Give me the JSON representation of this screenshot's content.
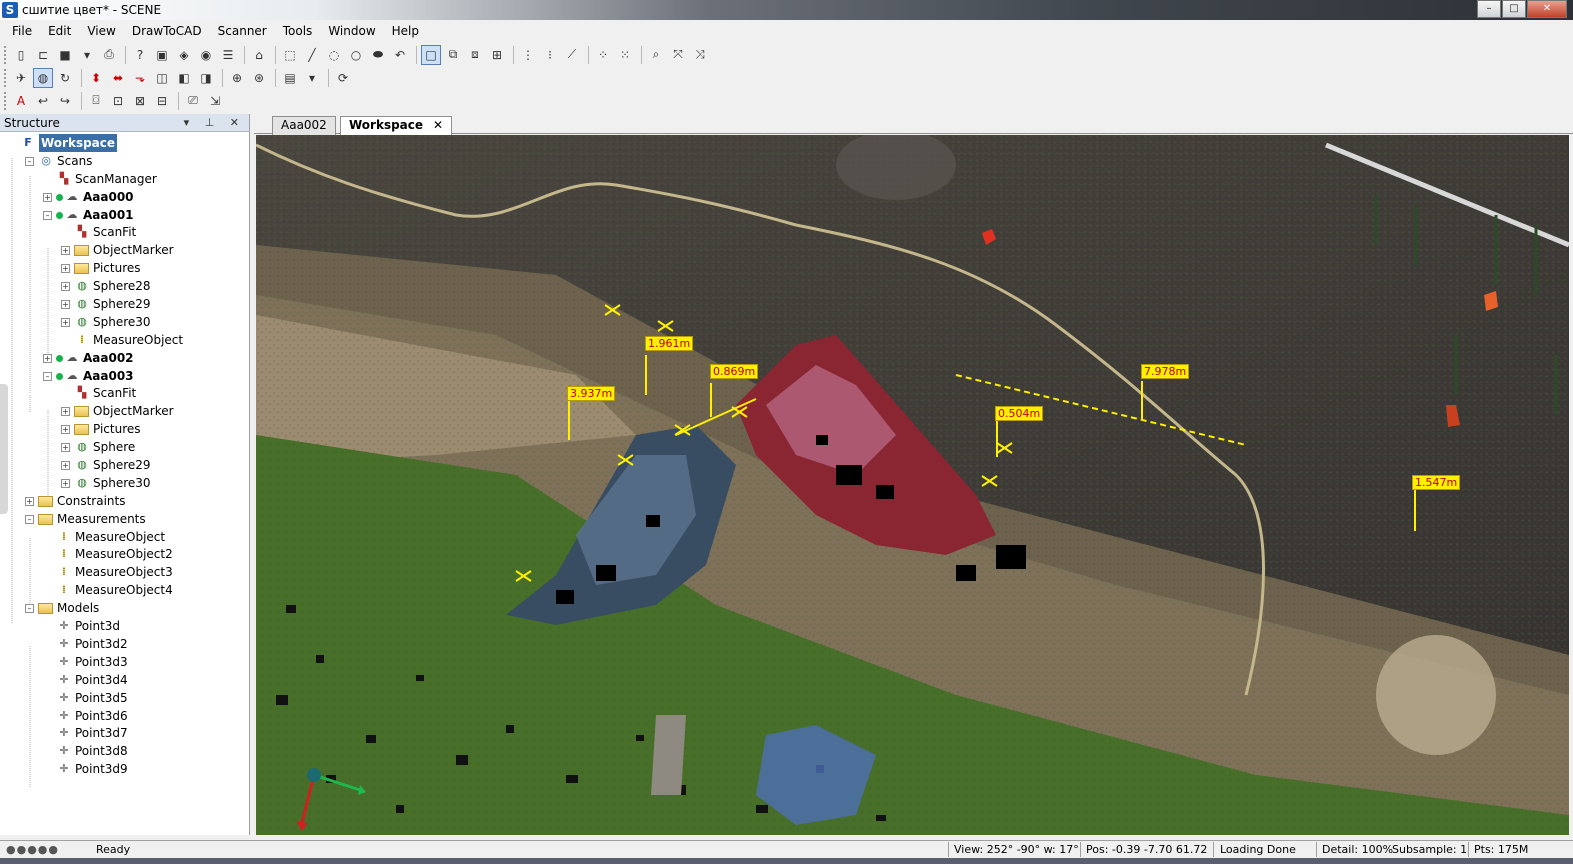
{
  "window": {
    "title": "сшитие цвет* - SCENE",
    "app_icon": "S",
    "controls": {
      "minimize": "–",
      "maximize": "□",
      "close": "✕"
    }
  },
  "menu": [
    "File",
    "Edit",
    "View",
    "DrawToCAD",
    "Scanner",
    "Tools",
    "Window",
    "Help"
  ],
  "structure_panel": {
    "title": "Structure",
    "header_buttons": "▾ ⊥ ✕",
    "tree": [
      {
        "label": "Workspace",
        "selected": true
      },
      {
        "label": "Scans"
      },
      {
        "label": "ScanManager"
      },
      {
        "label": "Aaa000"
      },
      {
        "label": "Aaa001"
      },
      {
        "label": "ScanFit"
      },
      {
        "label": "ObjectMarker"
      },
      {
        "label": "Pictures"
      },
      {
        "label": "Sphere28"
      },
      {
        "label": "Sphere29"
      },
      {
        "label": "Sphere30"
      },
      {
        "label": "MeasureObject"
      },
      {
        "label": "Aaa002"
      },
      {
        "label": "Aaa003"
      },
      {
        "label": "ScanFit"
      },
      {
        "label": "ObjectMarker"
      },
      {
        "label": "Pictures"
      },
      {
        "label": "Sphere"
      },
      {
        "label": "Sphere29"
      },
      {
        "label": "Sphere30"
      },
      {
        "label": "Constraints"
      },
      {
        "label": "Measurements"
      },
      {
        "label": "MeasureObject"
      },
      {
        "label": "MeasureObject2"
      },
      {
        "label": "MeasureObject3"
      },
      {
        "label": "MeasureObject4"
      },
      {
        "label": "Models"
      },
      {
        "label": "Point3d"
      },
      {
        "label": "Point3d2"
      },
      {
        "label": "Point3d3"
      },
      {
        "label": "Point3d4"
      },
      {
        "label": "Point3d5"
      },
      {
        "label": "Point3d6"
      },
      {
        "label": "Point3d7"
      },
      {
        "label": "Point3d8"
      },
      {
        "label": "Point3d9"
      }
    ]
  },
  "tabs": [
    {
      "label": "Aaa002",
      "active": false
    },
    {
      "label": "Workspace",
      "active": true,
      "close": "✕"
    }
  ],
  "measurements": [
    "1.961m",
    "0.869m",
    "3.937m",
    "7.978m",
    "0.504m",
    "1.547m"
  ],
  "status": {
    "indicator": "●●●●●",
    "text": "Ready",
    "view": "View: 252° -90° w: 17°",
    "pos": "Pos:  -0.39  -7.70  61.72",
    "loading": "Loading Done",
    "detail": "Detail: 100%",
    "subsample": "Subsample:  1",
    "pts": "Pts: 175M"
  },
  "colors": {
    "measure_label_bg": "#ffef00",
    "measure_label_text": "#c00000",
    "selection": "#3a6ea5",
    "scan_dot": "#15b34a"
  }
}
